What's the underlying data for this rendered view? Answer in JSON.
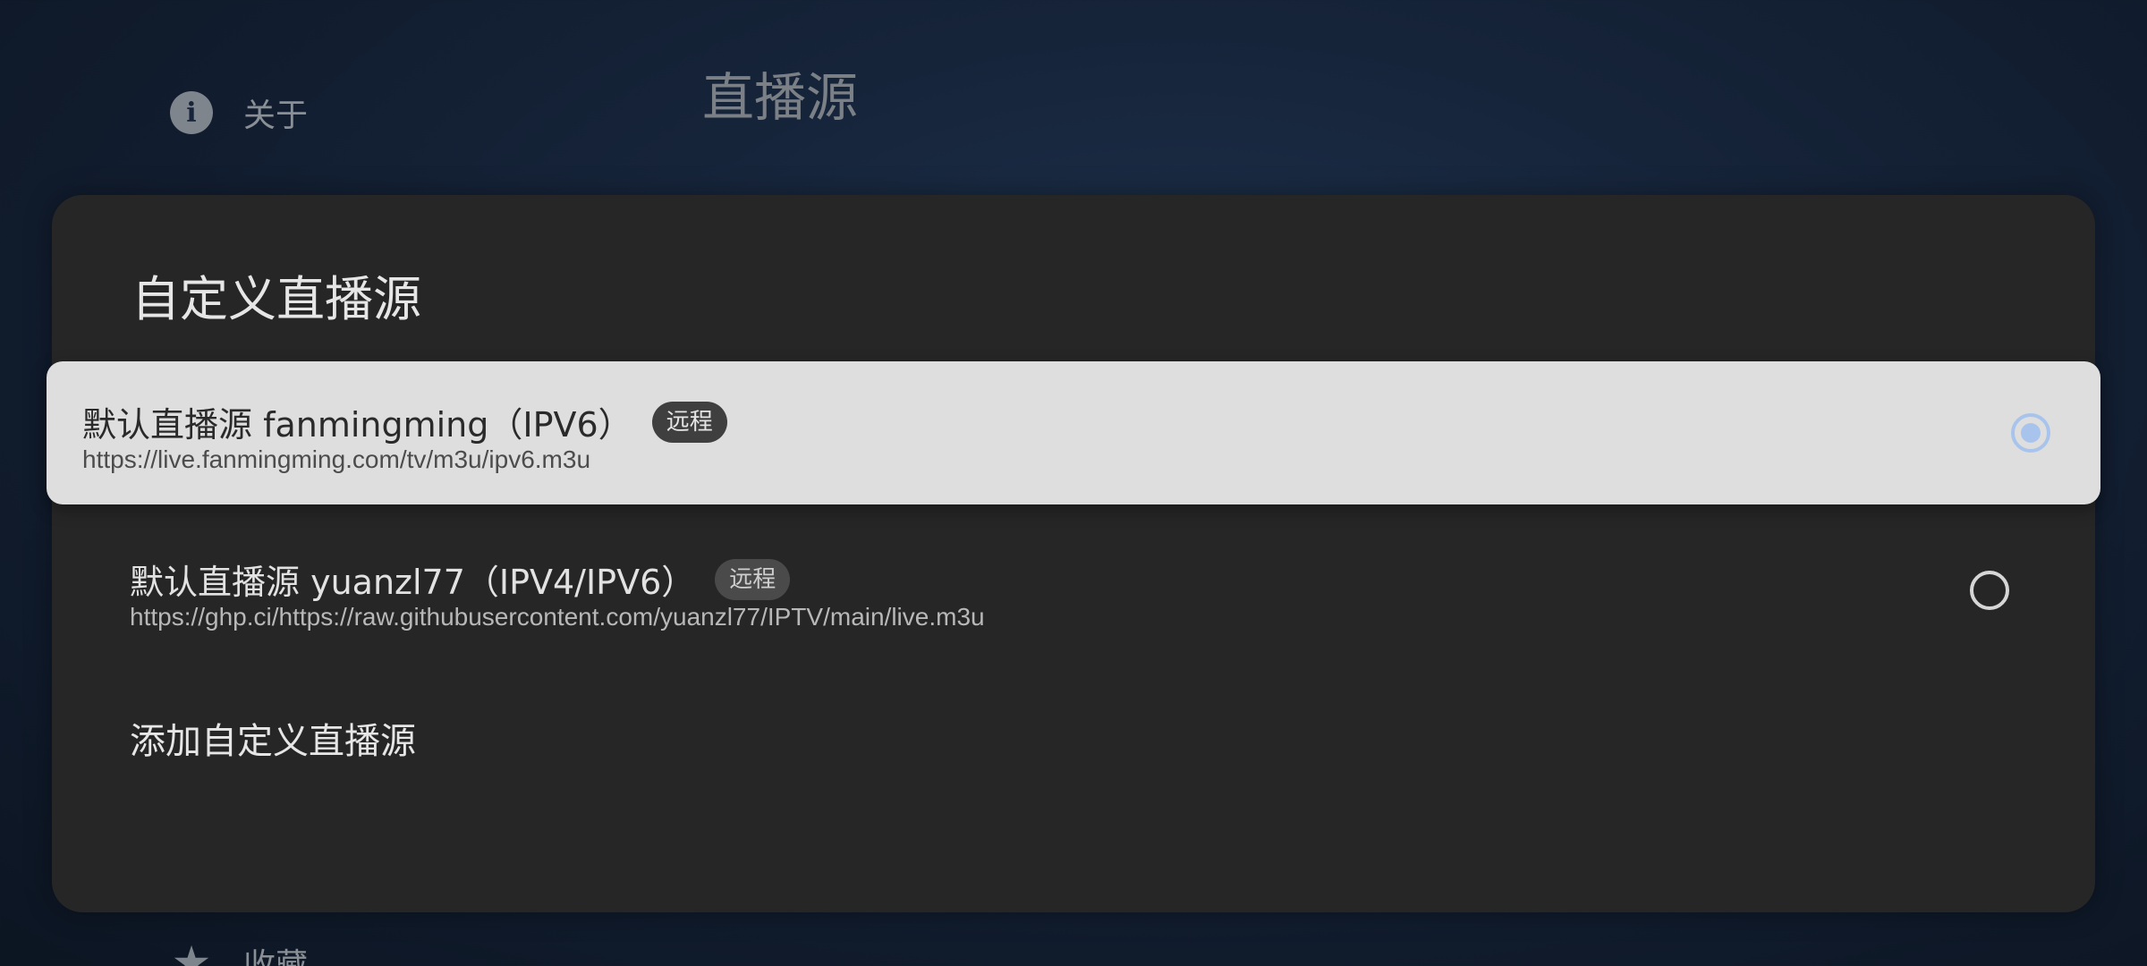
{
  "background": {
    "nav_items": [
      {
        "label": "关于",
        "icon": "info-icon"
      },
      {
        "label": "收藏",
        "icon": "star-icon"
      }
    ],
    "page_title": "直播源"
  },
  "dialog": {
    "title": "自定义直播源",
    "sources": [
      {
        "name": "默认直播源 fanmingming（IPV6）",
        "badge": "远程",
        "url": "https://live.fanmingming.com/tv/m3u/ipv6.m3u",
        "selected": true
      },
      {
        "name": "默认直播源 yuanzl77（IPV4/IPV6）",
        "badge": "远程",
        "url": "https://ghp.ci/https://raw.githubusercontent.com/yuanzl77/IPTV/main/live.m3u",
        "selected": false
      }
    ],
    "add_label": "添加自定义直播源"
  },
  "colors": {
    "accent": "#a9c4ec",
    "dialog_bg": "#262626",
    "selected_row_bg": "#dedede"
  }
}
